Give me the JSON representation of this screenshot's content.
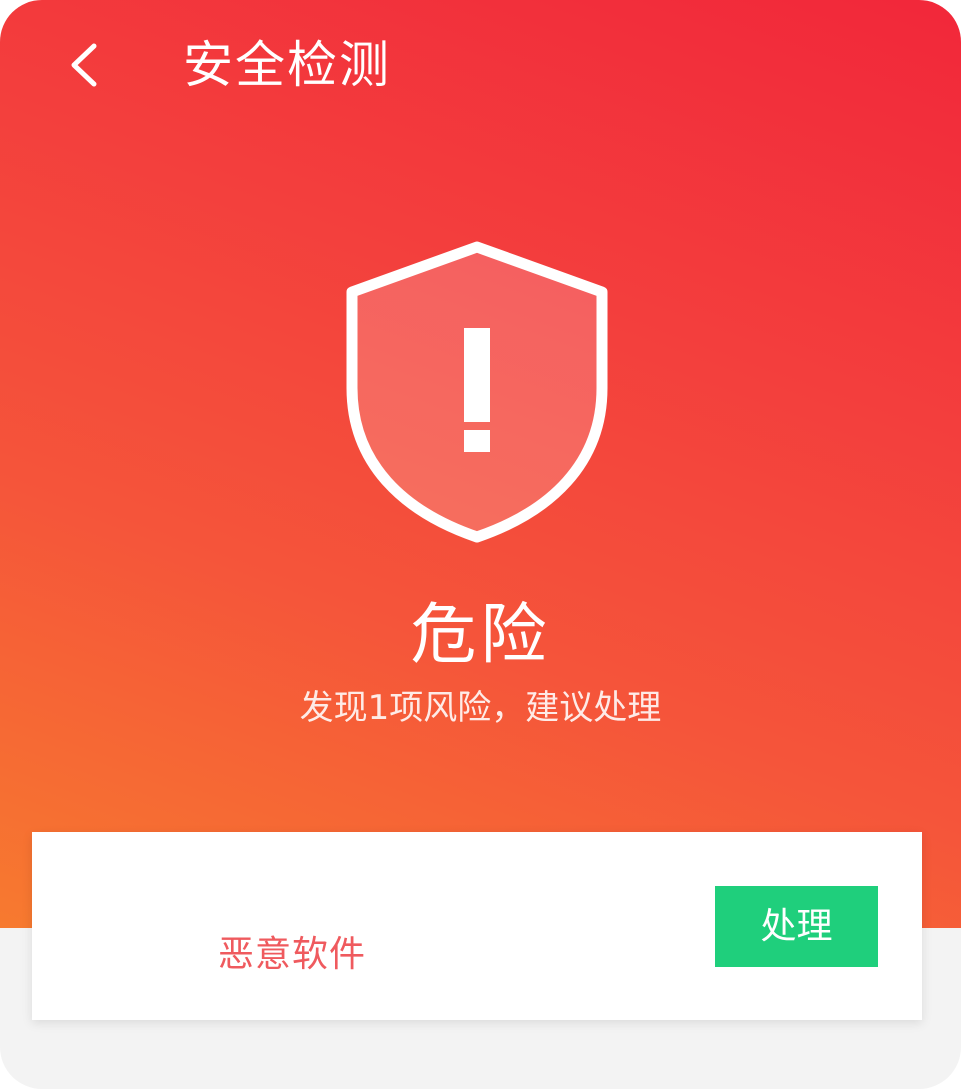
{
  "header": {
    "back_icon": "chevron-left-icon",
    "title": "安全检测"
  },
  "status": {
    "icon": "shield-warning-icon",
    "title": "危险",
    "subtitle": "发现1项风险，建议处理"
  },
  "risks": [
    {
      "name": "恶意软件",
      "action_label": "处理"
    }
  ],
  "colors": {
    "gradient_top": "#f2273a",
    "gradient_bottom": "#f77a2f",
    "risk_text": "#ef5a5e",
    "action_button": "#1fcf7c"
  }
}
